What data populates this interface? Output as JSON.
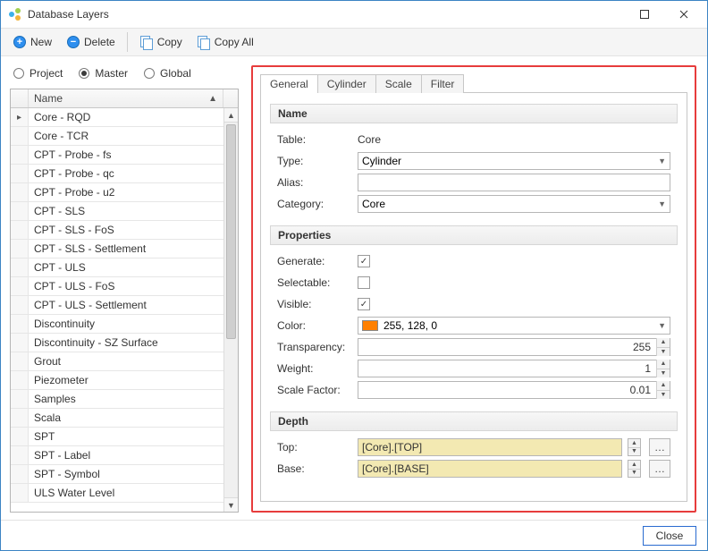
{
  "window": {
    "title": "Database Layers"
  },
  "toolbar": {
    "new": "New",
    "delete": "Delete",
    "copy": "Copy",
    "copy_all": "Copy All"
  },
  "radios": {
    "project": "Project",
    "master": "Master",
    "global": "Global",
    "selected": "master"
  },
  "grid": {
    "header": "Name",
    "rows": [
      "Core - RQD",
      "Core - TCR",
      "CPT - Probe - fs",
      "CPT - Probe - qc",
      "CPT - Probe - u2",
      "CPT - SLS",
      "CPT - SLS - FoS",
      "CPT - SLS - Settlement",
      "CPT - ULS",
      "CPT - ULS - FoS",
      "CPT - ULS - Settlement",
      "Discontinuity",
      "Discontinuity - SZ Surface",
      "Grout",
      "Piezometer",
      "Samples",
      "Scala",
      "SPT",
      "SPT - Label",
      "SPT - Symbol",
      "ULS Water Level"
    ]
  },
  "tabs": {
    "general": "General",
    "cylinder": "Cylinder",
    "scale": "Scale",
    "filter": "Filter"
  },
  "sections": {
    "name": {
      "header": "Name",
      "table_label": "Table:",
      "table_value": "Core",
      "type_label": "Type:",
      "type_value": "Cylinder",
      "alias_label": "Alias:",
      "alias_value": "",
      "category_label": "Category:",
      "category_value": "Core"
    },
    "props": {
      "header": "Properties",
      "generate_label": "Generate:",
      "selectable_label": "Selectable:",
      "visible_label": "Visible:",
      "color_label": "Color:",
      "color_text": "255, 128, 0",
      "transparency_label": "Transparency:",
      "transparency_value": "255",
      "weight_label": "Weight:",
      "weight_value": "1",
      "scalefactor_label": "Scale Factor:",
      "scalefactor_value": "0.01"
    },
    "depth": {
      "header": "Depth",
      "top_label": "Top:",
      "top_value": "[Core].[TOP]",
      "base_label": "Base:",
      "base_value": "[Core].[BASE]"
    }
  },
  "footer": {
    "close": "Close"
  }
}
